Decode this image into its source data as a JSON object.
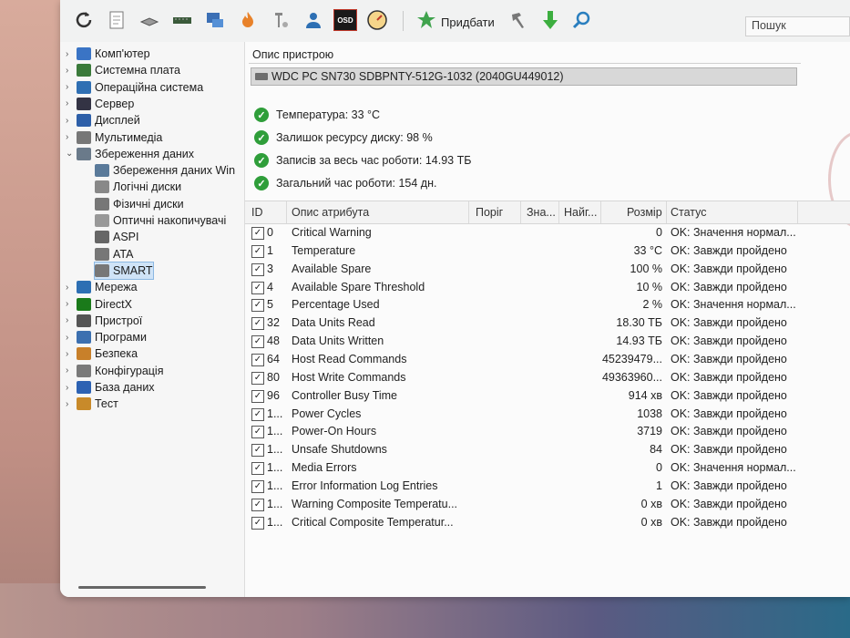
{
  "toolbar": {
    "add_label": "Придбати",
    "search_placeholder": "Пошук",
    "osd_label": "OSD"
  },
  "sidebar": {
    "items": [
      {
        "label": "Комп'ютер",
        "expander": "›"
      },
      {
        "label": "Системна плата",
        "expander": "›"
      },
      {
        "label": "Операційна система",
        "expander": "›"
      },
      {
        "label": "Сервер",
        "expander": "›"
      },
      {
        "label": "Дисплей",
        "expander": "›"
      },
      {
        "label": "Мультимедіа",
        "expander": "›"
      },
      {
        "label": "Збереження даних",
        "expander": "⌄"
      },
      {
        "label": "Збереження даних Win"
      },
      {
        "label": "Логічні диски"
      },
      {
        "label": "Фізичні диски"
      },
      {
        "label": "Оптичні накопичувачі"
      },
      {
        "label": "ASPI"
      },
      {
        "label": "ATA"
      },
      {
        "label": "SMART"
      },
      {
        "label": "Мережа",
        "expander": "›"
      },
      {
        "label": "DirectX",
        "expander": "›"
      },
      {
        "label": "Пристрої",
        "expander": "›"
      },
      {
        "label": "Програми",
        "expander": "›"
      },
      {
        "label": "Безпека",
        "expander": "›"
      },
      {
        "label": "Конфігурація",
        "expander": "›"
      },
      {
        "label": "База даних",
        "expander": "›"
      },
      {
        "label": "Тест",
        "expander": "›"
      }
    ]
  },
  "device": {
    "header": "Опис пристрою",
    "name": "WDC PC SN730 SDBPNTY-512G-1032 (2040GU449012)"
  },
  "summary": [
    "Температура: 33 °C",
    "Залишок ресурсу диску: 98 %",
    "Записів за весь час роботи: 14.93 ТБ",
    "Загальний час роботи: 154 дн."
  ],
  "table": {
    "columns": {
      "id": "ID",
      "name": "Опис атрибута",
      "threshold": "Поріг",
      "value": "Зна...",
      "worst": "Найг...",
      "size": "Розмір",
      "status": "Статус"
    },
    "rows": [
      {
        "id": "0",
        "name": "Critical Warning",
        "size": "0",
        "status": "OK: Значення нормал..."
      },
      {
        "id": "1",
        "name": "Temperature",
        "size": "33 °C",
        "status": "OK: Завжди пройдено"
      },
      {
        "id": "3",
        "name": "Available Spare",
        "size": "100 %",
        "status": "OK: Завжди пройдено"
      },
      {
        "id": "4",
        "name": "Available Spare Threshold",
        "size": "10 %",
        "status": "OK: Завжди пройдено"
      },
      {
        "id": "5",
        "name": "Percentage Used",
        "size": "2 %",
        "status": "OK: Значення нормал..."
      },
      {
        "id": "32",
        "name": "Data Units Read",
        "size": "18.30 ТБ",
        "status": "OK: Завжди пройдено"
      },
      {
        "id": "48",
        "name": "Data Units Written",
        "size": "14.93 ТБ",
        "status": "OK: Завжди пройдено"
      },
      {
        "id": "64",
        "name": "Host Read Commands",
        "size": "45239479...",
        "status": "OK: Завжди пройдено"
      },
      {
        "id": "80",
        "name": "Host Write Commands",
        "size": "49363960...",
        "status": "OK: Завжди пройдено"
      },
      {
        "id": "96",
        "name": "Controller Busy Time",
        "size": "914 хв",
        "status": "OK: Завжди пройдено"
      },
      {
        "id": "1...",
        "name": "Power Cycles",
        "size": "1038",
        "status": "OK: Завжди пройдено"
      },
      {
        "id": "1...",
        "name": "Power-On Hours",
        "size": "3719",
        "status": "OK: Завжди пройдено"
      },
      {
        "id": "1...",
        "name": "Unsafe Shutdowns",
        "size": "84",
        "status": "OK: Завжди пройдено"
      },
      {
        "id": "1...",
        "name": "Media Errors",
        "size": "0",
        "status": "OK: Значення нормал..."
      },
      {
        "id": "1...",
        "name": "Error Information Log Entries",
        "size": "1",
        "status": "OK: Завжди пройдено"
      },
      {
        "id": "1...",
        "name": "Warning Composite Temperatu...",
        "size": "0 хв",
        "status": "OK: Завжди пройдено"
      },
      {
        "id": "1...",
        "name": "Critical Composite Temperatur...",
        "size": "0 хв",
        "status": "OK: Завжди пройдено"
      }
    ]
  }
}
